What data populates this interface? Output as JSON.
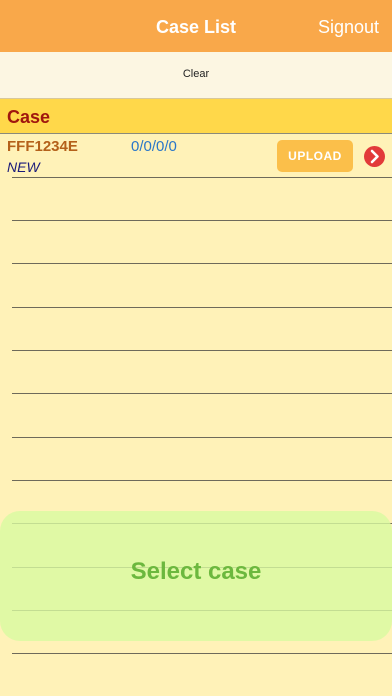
{
  "navbar": {
    "title": "Case List",
    "signout_label": "Signout"
  },
  "toolbar": {
    "clear_label": "Clear"
  },
  "section": {
    "title": "Case"
  },
  "cases": [
    {
      "id": "FFF1234E",
      "counts": "0/0/0/0",
      "status": "NEW",
      "upload_label": "UPLOAD"
    }
  ],
  "overlay": {
    "label": "Select case"
  },
  "colors": {
    "navbar_bg": "#f9a84a",
    "section_bg": "#ffd84a",
    "list_bg": "#fff2b8",
    "upload_bg": "#fbbf4a",
    "chevron_bg": "#e23a3a",
    "overlay_text": "#6cb83e"
  },
  "icons": {
    "row_disclosure": "chevron-right-circle-icon"
  }
}
